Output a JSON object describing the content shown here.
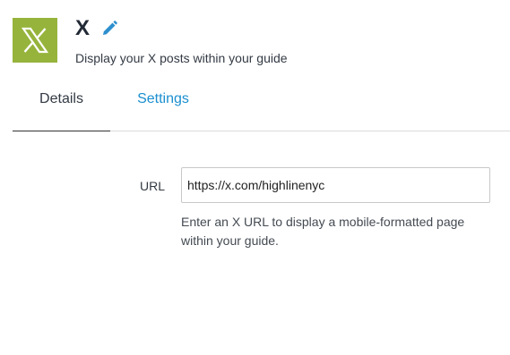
{
  "header": {
    "logo_icon": "x-logo-icon",
    "logo_color": "#96b43c",
    "title": "X",
    "edit_icon": "pencil-icon",
    "subtitle": "Display your X posts within your guide"
  },
  "tabs": [
    {
      "label": "Details",
      "active": true
    },
    {
      "label": "Settings",
      "active": false
    }
  ],
  "form": {
    "url_label": "URL",
    "url_value": "https://x.com/highlinenyc",
    "help_text": "Enter an X URL to display a mobile-formatted page within your guide."
  },
  "colors": {
    "accent": "#1a8fcf",
    "title": "#222a35"
  }
}
